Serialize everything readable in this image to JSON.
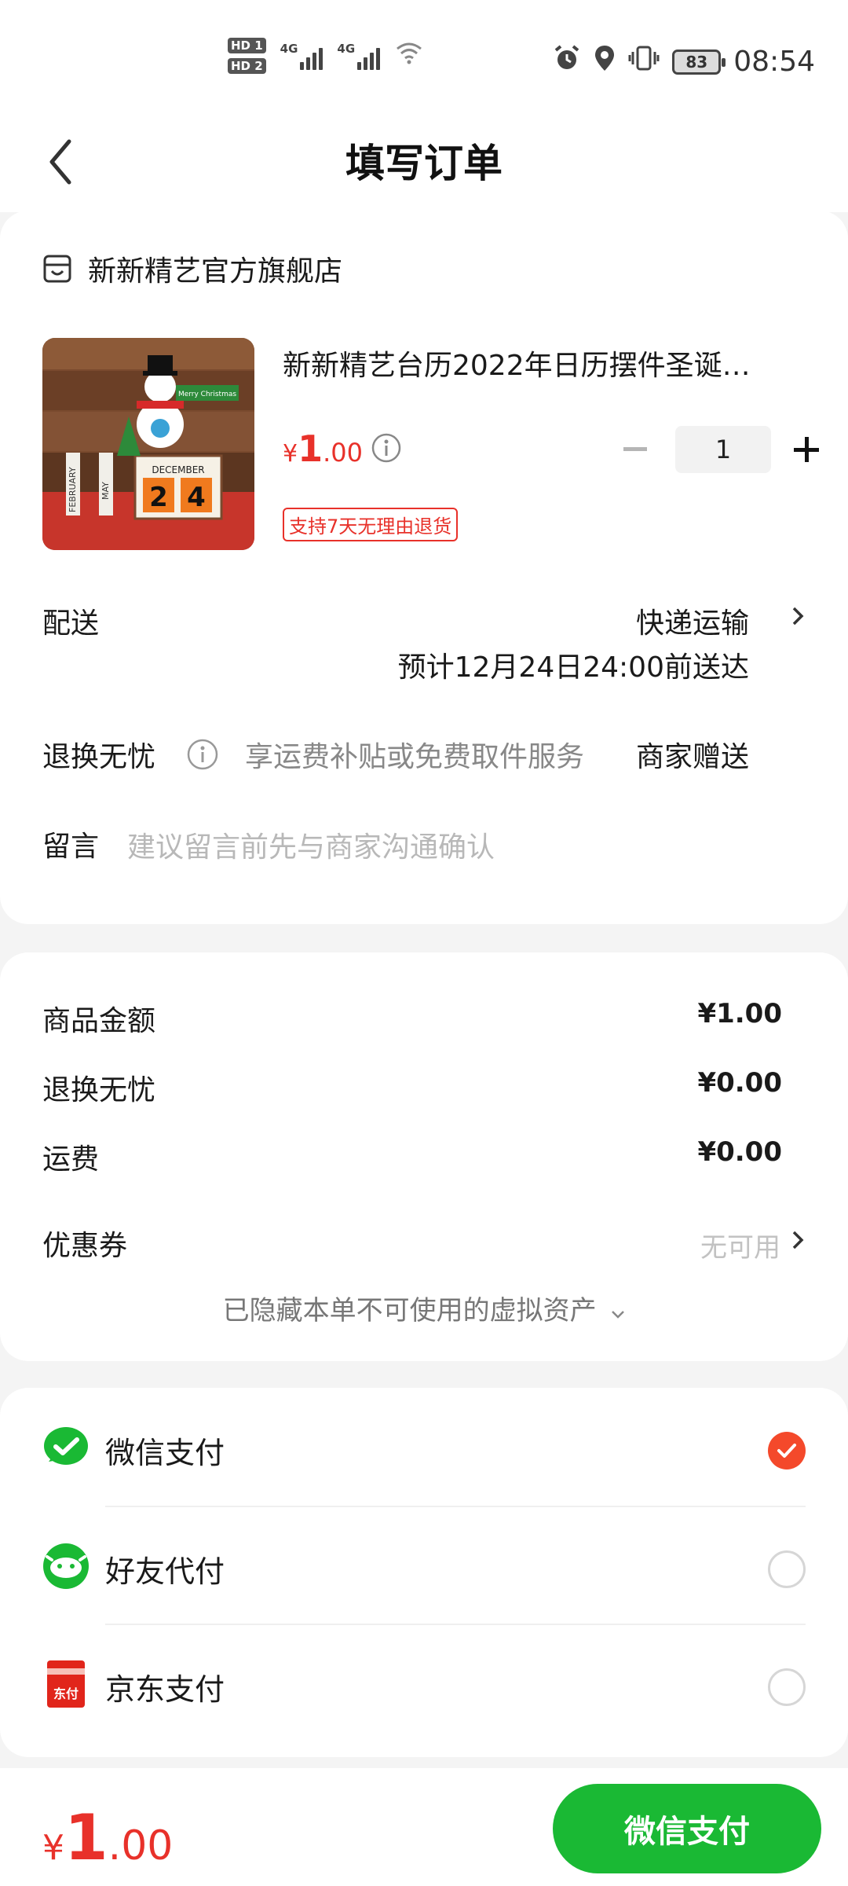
{
  "status_bar": {
    "sim1": "HD 1",
    "sim2": "HD 2",
    "network1": "4G",
    "network2": "4G",
    "battery": "83",
    "time": "08:54",
    "icons": [
      "alarm-icon",
      "location-icon",
      "vibrate-icon",
      "wifi-icon"
    ]
  },
  "header": {
    "title": "填写订单"
  },
  "store": {
    "name": "新新精艺官方旗舰店"
  },
  "product": {
    "title": "新新精艺台历2022年日历摆件圣诞…",
    "price_currency": "¥",
    "price_int": "1",
    "price_dec": ".00",
    "quantity": "1",
    "return_tag": "支持7天无理由退货",
    "image_text": {
      "month": "DECEMBER",
      "day_tens": "2",
      "day_ones": "4",
      "block1": "FEBRUARY",
      "block2": "MAY",
      "sign": "Merry Christmas"
    }
  },
  "delivery": {
    "label": "配送",
    "method": "快递运输",
    "eta": "预计12月24日24:00前送达"
  },
  "returns": {
    "label": "退换无忧",
    "desc": "享运费补贴或免费取件服务",
    "value": "商家赠送"
  },
  "message": {
    "label": "留言",
    "placeholder": "建议留言前先与商家沟通确认"
  },
  "summary": {
    "items": [
      {
        "label": "商品金额",
        "value": "¥1.00"
      },
      {
        "label": "退换无忧",
        "value": "¥0.00"
      },
      {
        "label": "运费",
        "value": "¥0.00"
      }
    ],
    "coupon_label": "优惠券",
    "coupon_value": "无可用",
    "hidden_assets": "已隐藏本单不可使用的虚拟资产"
  },
  "payment": {
    "options": [
      {
        "label": "微信支付",
        "selected": true
      },
      {
        "label": "好友代付",
        "selected": false
      },
      {
        "label": "京东支付",
        "selected": false
      }
    ],
    "jd_badge": "东付"
  },
  "bottom": {
    "currency": "¥",
    "total_int": "1",
    "total_dec": ".00",
    "pay_button": "微信支付"
  },
  "colors": {
    "price_red": "#e8312a",
    "wechat_green": "#1ab934",
    "radio_selected": "#f4492b"
  }
}
